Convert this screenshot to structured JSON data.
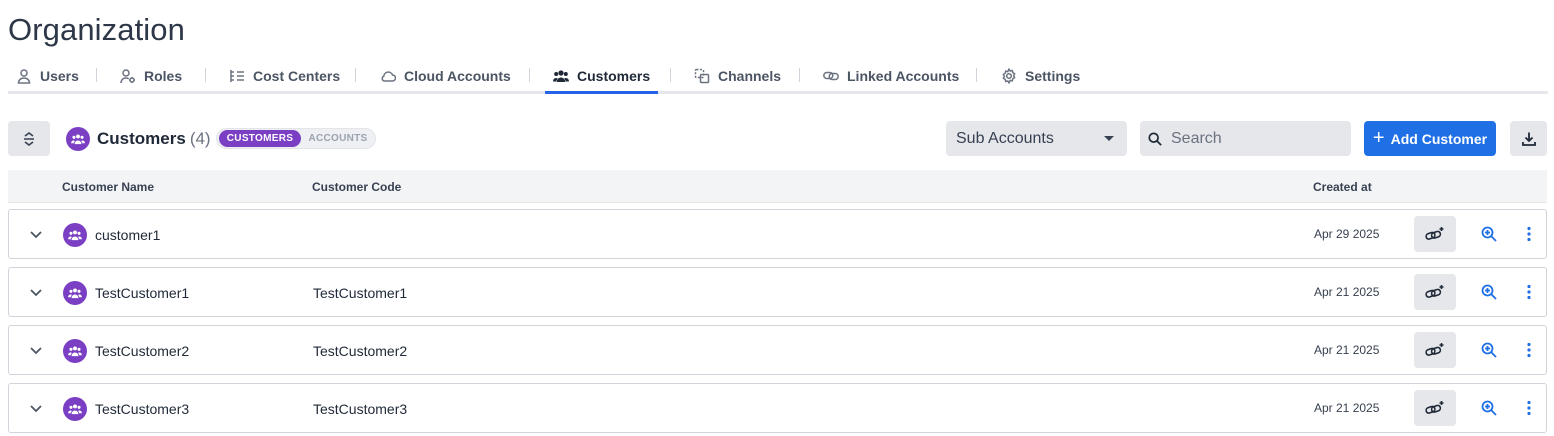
{
  "page": {
    "title": "Organization"
  },
  "tabs": [
    {
      "label": "Users",
      "icon": "user-icon"
    },
    {
      "label": "Roles",
      "icon": "user-gear-icon"
    },
    {
      "label": "Cost Centers",
      "icon": "list-tree-icon"
    },
    {
      "label": "Cloud Accounts",
      "icon": "cloud-icon"
    },
    {
      "label": "Customers",
      "icon": "users-icon",
      "active": true
    },
    {
      "label": "Channels",
      "icon": "channels-icon"
    },
    {
      "label": "Linked Accounts",
      "icon": "link-icon"
    },
    {
      "label": "Settings",
      "icon": "gear-icon"
    }
  ],
  "header": {
    "title": "Customers",
    "count": "(4)",
    "toggle": {
      "active": "CUSTOMERS",
      "inactive": "ACCOUNTS"
    }
  },
  "filter": {
    "selected": "Sub Accounts"
  },
  "search": {
    "placeholder": "Search",
    "value": ""
  },
  "actions": {
    "add_label": "Add Customer"
  },
  "table": {
    "columns": {
      "name": "Customer Name",
      "code": "Customer Code",
      "created": "Created at"
    },
    "rows": [
      {
        "name": "customer1",
        "code": "",
        "created": "Apr 29 2025"
      },
      {
        "name": "TestCustomer1",
        "code": "TestCustomer1",
        "created": "Apr 21 2025"
      },
      {
        "name": "TestCustomer2",
        "code": "TestCustomer2",
        "created": "Apr 21 2025"
      },
      {
        "name": "TestCustomer3",
        "code": "TestCustomer3",
        "created": "Apr 21 2025"
      }
    ]
  },
  "colors": {
    "accent": "#1f6fe5",
    "entity": "#7b3fc4",
    "tab_underline": "#2563eb"
  }
}
